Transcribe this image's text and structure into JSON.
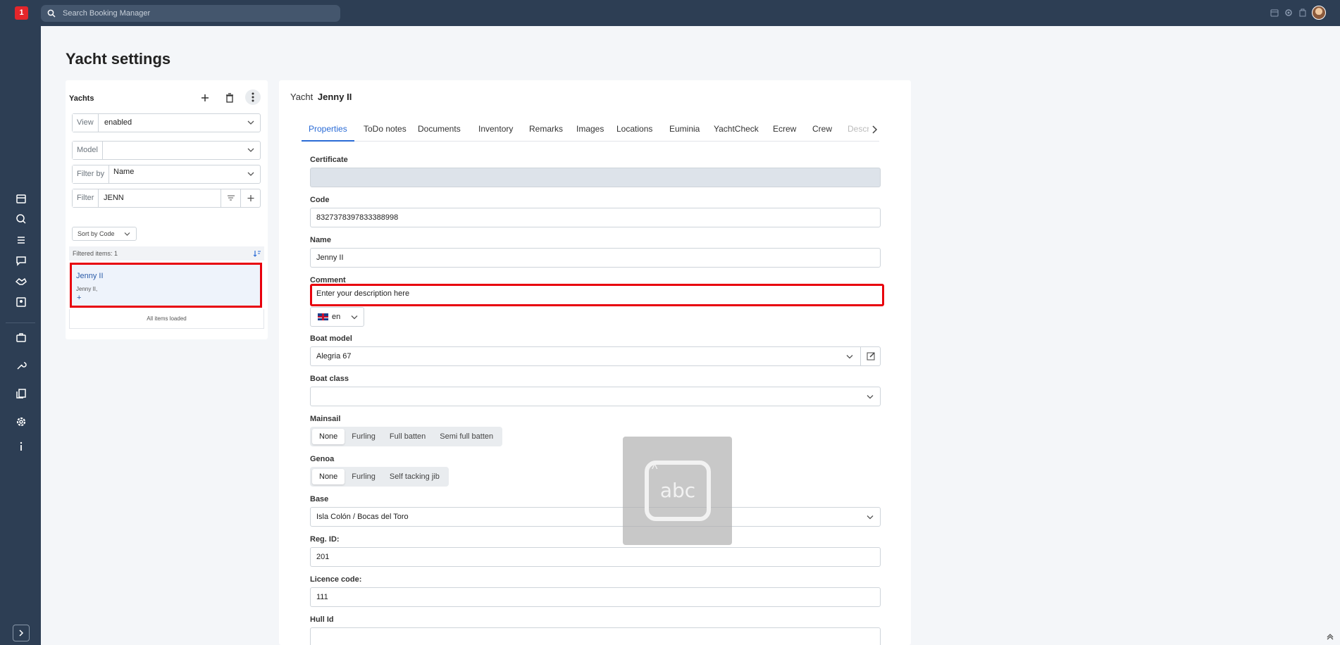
{
  "topbar": {
    "logo_text": "1",
    "search_placeholder": "Search Booking Manager"
  },
  "page": {
    "title": "Yacht settings"
  },
  "yachts": {
    "title": "Yachts",
    "view_label": "View",
    "view_value": "enabled",
    "model_label": "Model",
    "model_value": "",
    "filter_by_label": "Filter by",
    "filter_by_value": "Name",
    "filter_label": "Filter",
    "filter_value": "JENN",
    "sort_label": "Sort by Code",
    "filtered_count": "Filtered items: 1",
    "items": [
      {
        "name": "Jenny II",
        "sub": "Jenny II,"
      }
    ],
    "item_plus": "+",
    "all_loaded": "All items loaded"
  },
  "main": {
    "head_prefix": "Yacht",
    "head_name": "Jenny II",
    "tabs": [
      "Properties",
      "ToDo notes",
      "Documents",
      "Inventory",
      "Remarks",
      "Images",
      "Locations",
      "Euminia",
      "YachtCheck",
      "Ecrew",
      "Crew",
      "Descr"
    ],
    "fields": {
      "certificate_label": "Certificate",
      "certificate_value": "",
      "code_label": "Code",
      "code_value": "8327378397833388998",
      "name_label": "Name",
      "name_value": "Jenny II",
      "comment_label": "Comment",
      "comment_placeholder": "Enter your description here",
      "language": "en",
      "boat_model_label": "Boat model",
      "boat_model_value": "Alegria 67",
      "boat_class_label": "Boat class",
      "boat_class_value": "",
      "mainsail_label": "Mainsail",
      "mainsail_options": [
        "None",
        "Furling",
        "Full batten",
        "Semi full batten"
      ],
      "mainsail_selected": "None",
      "genoa_label": "Genoa",
      "genoa_options": [
        "None",
        "Furling",
        "Self tacking jib"
      ],
      "genoa_selected": "None",
      "base_label": "Base",
      "base_value": "Isla Colón / Bocas del Toro",
      "reg_id_label": "Reg. ID:",
      "reg_id_value": "201",
      "licence_label": "Licence code:",
      "licence_value": "111",
      "hull_label": "Hull Id",
      "hull_value": ""
    }
  },
  "overlay": {
    "text": "abc"
  },
  "colors": {
    "nav_bg": "#2d3e54",
    "accent": "#2a6bd6",
    "highlight": "#e8000c"
  }
}
